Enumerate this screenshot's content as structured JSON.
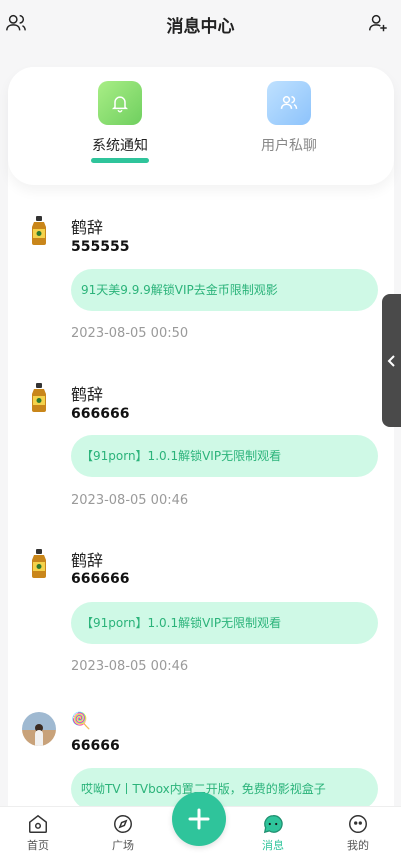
{
  "header": {
    "title": "消息中心",
    "left_icon": "contacts-icon",
    "right_icon": "add-user-icon"
  },
  "tabs": [
    {
      "label": "系统通知",
      "icon": "bell-icon",
      "active": true
    },
    {
      "label": "用户私聊",
      "icon": "users-icon",
      "active": false
    }
  ],
  "messages": [
    {
      "name": "鹤辞",
      "text": "555555",
      "bubble": "91天美9.9.9解锁VIP去金币限制观影",
      "time": "2023-08-05 00:50"
    },
    {
      "name": "鹤辞",
      "text": "666666",
      "bubble": "【91porn】1.0.1解锁VIP无限制观看",
      "time": "2023-08-05 00:46"
    },
    {
      "name": "鹤辞",
      "text": "666666",
      "bubble": "【91porn】1.0.1解锁VIP无限制观看",
      "time": "2023-08-05 00:46"
    },
    {
      "name": "🍭",
      "text": "66666",
      "bubble": "哎呦TV丨TVbox内置二开版，免费的影视盒子",
      "time": ""
    }
  ],
  "bottom_nav": [
    {
      "label": "首页",
      "icon": "home-icon",
      "active": false
    },
    {
      "label": "广场",
      "icon": "compass-icon",
      "active": false
    },
    {
      "label": "消息",
      "icon": "message-icon",
      "active": true
    },
    {
      "label": "我的",
      "icon": "profile-icon",
      "active": false
    }
  ],
  "fab": {
    "icon": "plus-icon"
  },
  "colors": {
    "accent": "#2fc49b",
    "bubble_bg": "#cff9e6",
    "bubble_text": "#2bb37a"
  }
}
